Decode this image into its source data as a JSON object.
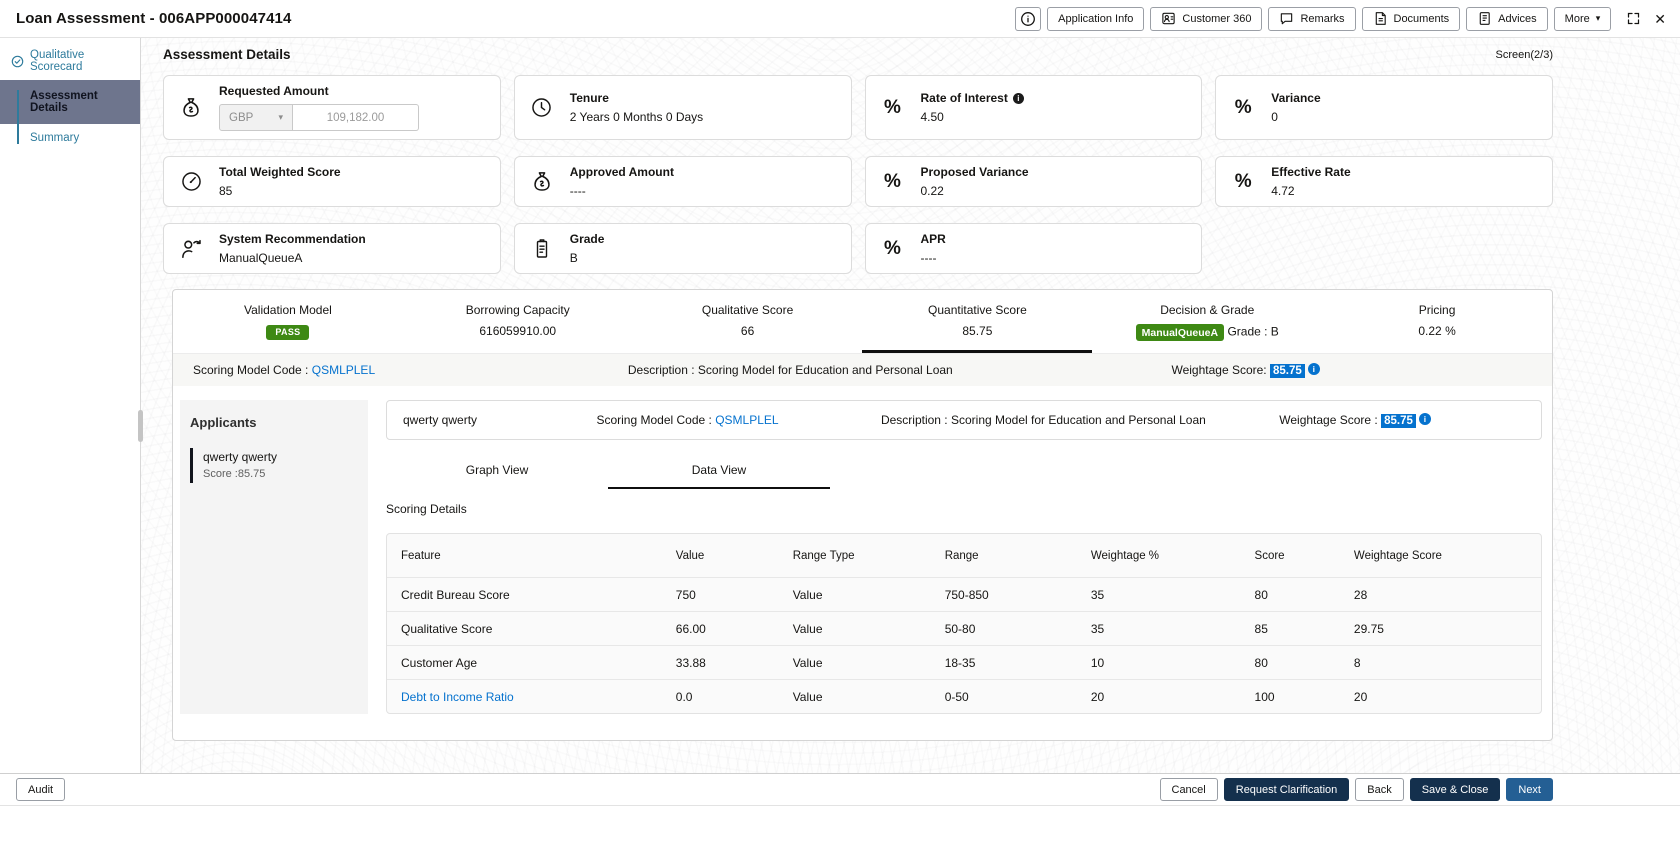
{
  "icons": {
    "close": "✕",
    "caret_down": "▾"
  },
  "colors": {
    "accent_blue": "#0572ce",
    "success_green": "#3e8914",
    "dark_button": "#14304d",
    "primary_button": "#245f94",
    "active_step_bg": "#6e758d"
  },
  "topbar": {
    "title": "Loan Assessment - 006APP000047414",
    "buttons": {
      "application_info": "Application Info",
      "customer_360": "Customer 360",
      "remarks": "Remarks",
      "documents": "Documents",
      "advices": "Advices",
      "more": "More"
    }
  },
  "sidebar": {
    "items": [
      {
        "label": "Qualitative Scorecard",
        "state": "completed"
      },
      {
        "label": "Assessment Details",
        "state": "active"
      },
      {
        "label": "Summary",
        "state": "pending"
      }
    ]
  },
  "main": {
    "title": "Assessment Details",
    "screen_indicator": "Screen(2/3)",
    "cards": {
      "requested_amount": {
        "label": "Requested Amount",
        "currency": "GBP",
        "amount": "109,182.00"
      },
      "tenure": {
        "label": "Tenure",
        "value": "2 Years 0 Months 0 Days"
      },
      "rate_of_interest": {
        "label": "Rate of Interest",
        "value": "4.50"
      },
      "variance": {
        "label": "Variance",
        "value": "0"
      },
      "total_weighted_score": {
        "label": "Total Weighted Score",
        "value": "85"
      },
      "approved_amount": {
        "label": "Approved Amount",
        "value": "----"
      },
      "proposed_variance": {
        "label": "Proposed Variance",
        "value": "0.22"
      },
      "effective_rate": {
        "label": "Effective Rate",
        "value": "4.72"
      },
      "system_recommendation": {
        "label": "System Recommendation",
        "value": "ManualQueueA"
      },
      "grade": {
        "label": "Grade",
        "value": "B"
      },
      "apr": {
        "label": "APR",
        "value": "----"
      }
    },
    "summary_tabs": {
      "validation_model": {
        "label": "Validation Model",
        "badge": "PASS"
      },
      "borrowing_capacity": {
        "label": "Borrowing Capacity",
        "value": "616059910.00"
      },
      "qualitative_score": {
        "label": "Qualitative Score",
        "value": "66"
      },
      "quantitative_score": {
        "label": "Quantitative Score",
        "value": "85.75"
      },
      "decision_grade": {
        "label": "Decision & Grade",
        "badge": "ManualQueueA",
        "grade": "Grade : B"
      },
      "pricing": {
        "label": "Pricing",
        "value": "0.22 %"
      }
    },
    "scoring_model_bar": {
      "code_label": "Scoring Model Code :",
      "code_value": "QSMLPLEL",
      "description": "Description : Scoring Model for Education and Personal Loan",
      "weightage_label": "Weightage Score:",
      "weightage_value": "85.75"
    },
    "applicants": {
      "heading": "Applicants",
      "items": [
        {
          "name": "qwerty qwerty",
          "score": "Score :85.75"
        }
      ]
    },
    "detail": {
      "applicant_name": "qwerty qwerty",
      "code_label": "Scoring Model Code :",
      "code_value": "QSMLPLEL",
      "description": "Description : Scoring Model for Education and Personal Loan",
      "weightage_label": "Weightage Score :",
      "weightage_value": "85.75",
      "tabs": {
        "graph": "Graph View",
        "data": "Data View"
      },
      "section_title": "Scoring Details",
      "table": {
        "headers": [
          "Feature",
          "Value",
          "Range Type",
          "Range",
          "Weightage %",
          "Score",
          "Weightage Score"
        ],
        "rows": [
          [
            "Credit Bureau Score",
            "750",
            "Value",
            "750-850",
            "35",
            "80",
            "28"
          ],
          [
            "Qualitative Score",
            "66.00",
            "Value",
            "50-80",
            "35",
            "85",
            "29.75"
          ],
          [
            "Customer Age",
            "33.88",
            "Value",
            "18-35",
            "10",
            "80",
            "8"
          ],
          [
            "Debt to Income Ratio",
            "0.0",
            "Value",
            "0-50",
            "20",
            "100",
            "20"
          ]
        ]
      }
    }
  },
  "footer": {
    "audit": "Audit",
    "cancel": "Cancel",
    "request_clarification": "Request Clarification",
    "back": "Back",
    "save_and_close": "Save & Close",
    "next": "Next"
  }
}
